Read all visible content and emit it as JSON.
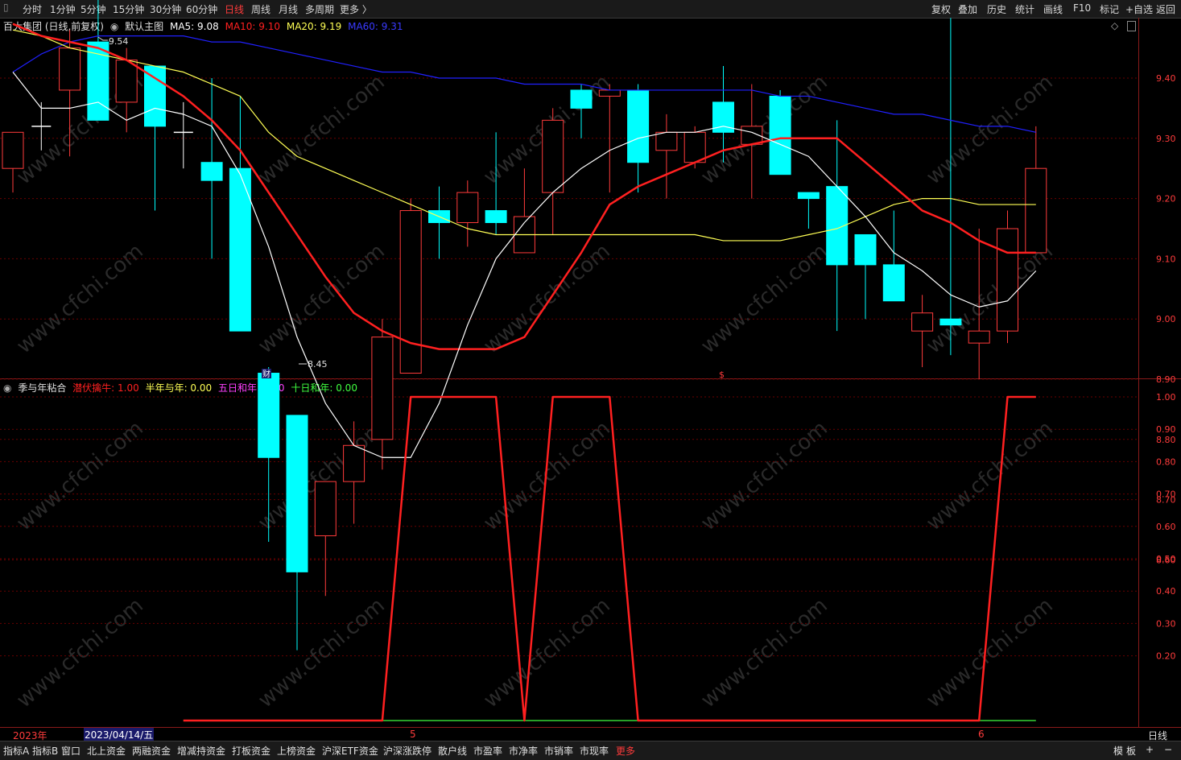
{
  "toolbar": {
    "left_items": [
      "分时",
      "1分钟",
      "5分钟",
      "15分钟",
      "30分钟",
      "60分钟",
      "日线",
      "周线",
      "月线",
      "多周期",
      "更多 〉"
    ],
    "active": "日线",
    "right_items": [
      "复权",
      "叠加",
      "历史",
      "统计",
      "画线",
      "F10",
      "标记",
      "+自选",
      "返回"
    ]
  },
  "main_legend": {
    "stock": "百大集团 (日线,前复权)",
    "template": "默认主图",
    "ma5_label": "MA5: 9.08",
    "ma10_label": "MA10: 9.10",
    "ma20_label": "MA20: 9.19",
    "ma60_label": "MA60: 9.31"
  },
  "sub_legend": {
    "name": "季与年粘合",
    "s1": "潜伏擒牛: 1.00",
    "s2": "半年与年: 0.00",
    "s3": "五日和年: 0.00",
    "s4": "十日和年: 0.00"
  },
  "colors": {
    "up": "#ff3b3b",
    "down": "#00ffff",
    "ma5": "#ffffff",
    "ma10": "#ff2020",
    "ma20": "#ffff55",
    "ma60": "#2020ff",
    "grid": "#6a0000",
    "axis": "#8a1a1a"
  },
  "annotations": {
    "high": "9.54",
    "low": "8.45",
    "fin_marker": "财",
    "dollar_marker": "$"
  },
  "axis_bar": {
    "year": "2023年",
    "cursor_date": "2023/04/14/五",
    "month_5": "5",
    "month_6": "6",
    "period": "日线"
  },
  "bottom_tabs": [
    "指标A",
    "指标B",
    "窗口",
    "北上资金",
    "两融资金",
    "增减持资金",
    "打板资金",
    "上榜资金",
    "沪深ETF资金",
    "沪深涨跌停",
    "散户线",
    "市盈率",
    "市净率",
    "市销率",
    "市现率",
    "更多"
  ],
  "bottom_right": [
    "模",
    "板",
    "+",
    "−"
  ],
  "watermark": "www.cfchi.com",
  "chart_data": [
    {
      "type": "candlestick",
      "title": "百大集团 (日线,前复权)",
      "yticks": [
        8.6,
        8.7,
        8.8,
        8.9,
        9.0,
        9.1,
        9.2,
        9.3,
        9.4
      ],
      "ylim": [
        8.42,
        9.56
      ],
      "candles": [
        {
          "o": 9.25,
          "c": 9.31,
          "h": 9.31,
          "l": 9.21
        },
        {
          "o": 9.32,
          "c": 9.32,
          "h": 9.36,
          "l": 9.28
        },
        {
          "o": 9.38,
          "c": 9.45,
          "h": 9.48,
          "l": 9.27
        },
        {
          "o": 9.46,
          "c": 9.33,
          "h": 9.54,
          "l": 9.33
        },
        {
          "o": 9.36,
          "c": 9.43,
          "h": 9.45,
          "l": 9.31
        },
        {
          "o": 9.42,
          "c": 9.32,
          "h": 9.42,
          "l": 9.18
        },
        {
          "o": 9.31,
          "c": 9.31,
          "h": 9.36,
          "l": 9.25
        },
        {
          "o": 9.26,
          "c": 9.23,
          "h": 9.4,
          "l": 9.1
        },
        {
          "o": 9.25,
          "c": 8.98,
          "h": 9.37,
          "l": 8.98
        },
        {
          "o": 8.91,
          "c": 8.77,
          "h": 8.92,
          "l": 8.63
        },
        {
          "o": 8.84,
          "c": 8.58,
          "h": 8.84,
          "l": 8.45
        },
        {
          "o": 8.64,
          "c": 8.73,
          "h": 8.73,
          "l": 8.54
        },
        {
          "o": 8.73,
          "c": 8.79,
          "h": 8.83,
          "l": 8.66
        },
        {
          "o": 8.8,
          "c": 8.97,
          "h": 9.0,
          "l": 8.75
        },
        {
          "o": 8.91,
          "c": 9.18,
          "h": 9.2,
          "l": 8.91
        },
        {
          "o": 9.18,
          "c": 9.16,
          "h": 9.22,
          "l": 9.1
        },
        {
          "o": 9.16,
          "c": 9.21,
          "h": 9.23,
          "l": 9.12
        },
        {
          "o": 9.18,
          "c": 9.16,
          "h": 9.31,
          "l": 9.14
        },
        {
          "o": 9.11,
          "c": 9.17,
          "h": 9.25,
          "l": 9.11
        },
        {
          "o": 9.21,
          "c": 9.33,
          "h": 9.35,
          "l": 9.14
        },
        {
          "o": 9.38,
          "c": 9.35,
          "h": 9.39,
          "l": 9.3
        },
        {
          "o": 9.37,
          "c": 9.38,
          "h": 9.39,
          "l": 9.21
        },
        {
          "o": 9.38,
          "c": 9.26,
          "h": 9.39,
          "l": 9.21
        },
        {
          "o": 9.28,
          "c": 9.31,
          "h": 9.34,
          "l": 9.2
        },
        {
          "o": 9.26,
          "c": 9.31,
          "h": 9.32,
          "l": 9.25
        },
        {
          "o": 9.36,
          "c": 9.31,
          "h": 9.42,
          "l": 9.26
        },
        {
          "o": 9.29,
          "c": 9.32,
          "h": 9.39,
          "l": 9.2
        },
        {
          "o": 9.37,
          "c": 9.24,
          "h": 9.38,
          "l": 9.24
        },
        {
          "o": 9.21,
          "c": 9.2,
          "h": 9.21,
          "l": 9.15
        },
        {
          "o": 9.22,
          "c": 9.09,
          "h": 9.33,
          "l": 8.98
        },
        {
          "o": 9.14,
          "c": 9.09,
          "h": 9.14,
          "l": 9.0
        },
        {
          "o": 9.09,
          "c": 9.03,
          "h": 9.18,
          "l": 9.03
        },
        {
          "o": 8.98,
          "c": 9.01,
          "h": 9.04,
          "l": 8.92
        },
        {
          "o": 9.0,
          "c": 8.99,
          "h": 9.5,
          "l": 8.94
        },
        {
          "o": 8.96,
          "c": 8.98,
          "h": 9.15,
          "l": 8.9
        },
        {
          "o": 8.98,
          "c": 9.15,
          "h": 9.18,
          "l": 8.96
        },
        {
          "o": 9.11,
          "c": 9.25,
          "h": 9.32,
          "l": 9.11
        }
      ],
      "ma5": [
        9.41,
        9.35,
        9.35,
        9.36,
        9.33,
        9.35,
        9.34,
        9.32,
        9.24,
        9.12,
        8.97,
        8.86,
        8.79,
        8.77,
        8.77,
        8.86,
        8.99,
        9.1,
        9.16,
        9.21,
        9.25,
        9.28,
        9.3,
        9.31,
        9.31,
        9.32,
        9.31,
        9.29,
        9.27,
        9.22,
        9.17,
        9.11,
        9.08,
        9.04,
        9.02,
        9.03,
        9.08
      ],
      "ma10": [
        9.49,
        9.47,
        9.46,
        9.45,
        9.43,
        9.4,
        9.37,
        9.33,
        9.28,
        9.21,
        9.14,
        9.07,
        9.01,
        8.98,
        8.96,
        8.95,
        8.95,
        8.95,
        8.97,
        9.04,
        9.11,
        9.19,
        9.22,
        9.24,
        9.26,
        9.28,
        9.29,
        9.3,
        9.3,
        9.3,
        9.26,
        9.22,
        9.18,
        9.16,
        9.13,
        9.11,
        9.11
      ],
      "ma20": [
        9.48,
        9.47,
        9.45,
        9.44,
        9.43,
        9.42,
        9.41,
        9.39,
        9.37,
        9.31,
        9.27,
        9.25,
        9.23,
        9.21,
        9.19,
        9.17,
        9.15,
        9.14,
        9.14,
        9.14,
        9.14,
        9.14,
        9.14,
        9.14,
        9.14,
        9.13,
        9.13,
        9.13,
        9.14,
        9.15,
        9.17,
        9.19,
        9.2,
        9.2,
        9.19,
        9.19,
        9.19
      ],
      "ma60": [
        9.41,
        9.44,
        9.46,
        9.47,
        9.47,
        9.47,
        9.47,
        9.46,
        9.46,
        9.45,
        9.44,
        9.43,
        9.42,
        9.41,
        9.41,
        9.4,
        9.4,
        9.4,
        9.39,
        9.39,
        9.39,
        9.38,
        9.38,
        9.38,
        9.38,
        9.38,
        9.38,
        9.37,
        9.37,
        9.36,
        9.35,
        9.34,
        9.34,
        9.33,
        9.32,
        9.32,
        9.31
      ]
    },
    {
      "type": "line",
      "title": "季与年粘合",
      "yticks": [
        0.2,
        0.3,
        0.4,
        0.5,
        0.6,
        0.7,
        0.8,
        0.9,
        1.0
      ],
      "ylim": [
        0,
        1.0
      ],
      "series": [
        {
          "name": "潜伏擒牛",
          "values": [
            null,
            null,
            null,
            null,
            null,
            null,
            0,
            0,
            0,
            0,
            0,
            0,
            0,
            0,
            1,
            1,
            1,
            1,
            0,
            1,
            1,
            1,
            0,
            0,
            0,
            0,
            0,
            0,
            0,
            0,
            0,
            0,
            0,
            0,
            0,
            1,
            1
          ]
        },
        {
          "name": "十日和年",
          "values": [
            null,
            null,
            null,
            null,
            null,
            null,
            0,
            0,
            0,
            0,
            0,
            0,
            0,
            0,
            0,
            0,
            0,
            0,
            0,
            0,
            0,
            0,
            0,
            0,
            0,
            0,
            0,
            0,
            0,
            0,
            0,
            0,
            0,
            0,
            0,
            0,
            0
          ]
        }
      ]
    }
  ]
}
